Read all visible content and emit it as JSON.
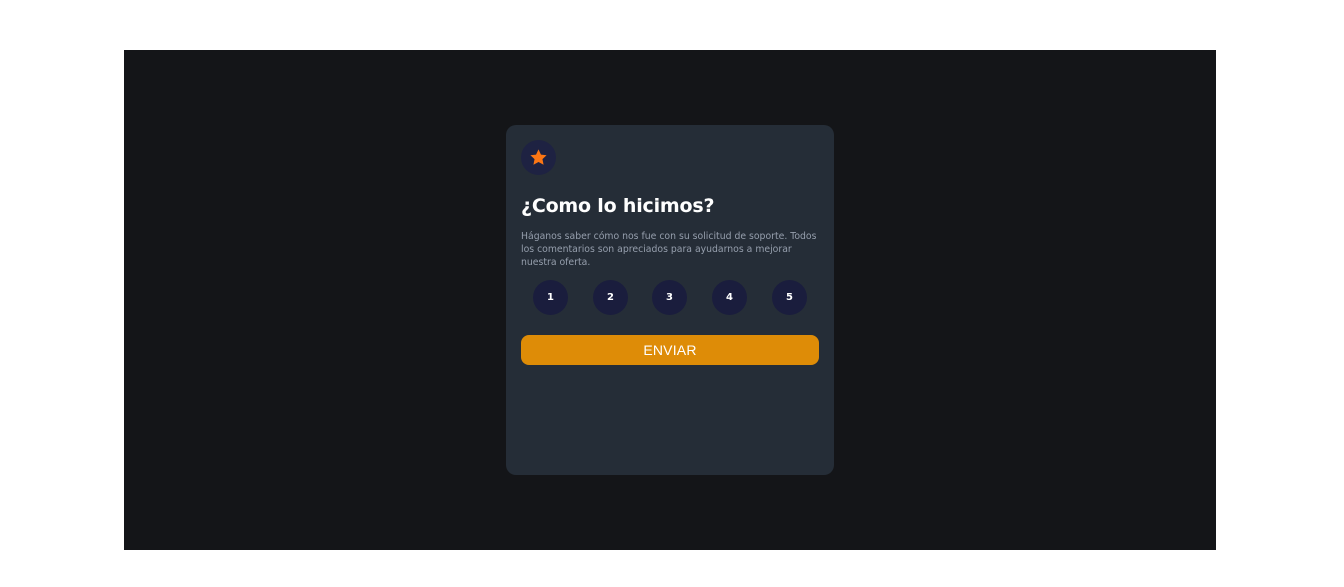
{
  "card": {
    "icon": "star-icon",
    "title": "¿Como lo hicimos?",
    "description": "Háganos saber cómo nos fue con su solicitud de soporte. Todos los comentarios son apreciados para ayudarnos a mejorar nuestra oferta.",
    "ratings": [
      "1",
      "2",
      "3",
      "4",
      "5"
    ],
    "submit_label": "ENVIAR"
  },
  "colors": {
    "accent": "#de8c07",
    "star": "#fc7614",
    "card_bg": "#252d37",
    "page_bg": "#141518"
  }
}
